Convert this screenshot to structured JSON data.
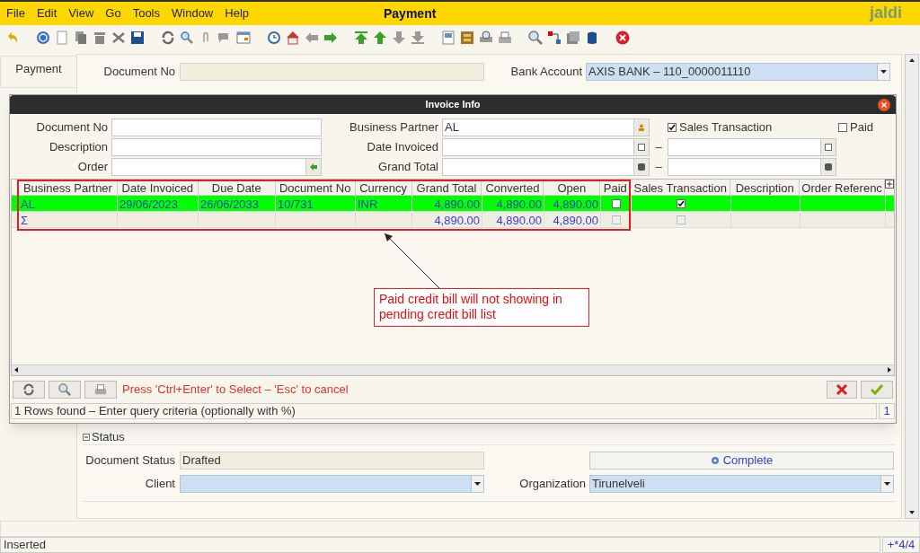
{
  "window": {
    "title": "Payment"
  },
  "menu": [
    "File",
    "Edit",
    "View",
    "Go",
    "Tools",
    "Window",
    "Help"
  ],
  "logo": "jaldi",
  "side_tabs": [
    {
      "label": "Payment",
      "selected": true
    }
  ],
  "form": {
    "document_no": {
      "label": "Document No"
    },
    "bank_account": {
      "label": "Bank Account",
      "value": "AXIS BANK – 110_0000011110"
    },
    "status_section": {
      "title": "Status",
      "expanded": true
    },
    "document_status": {
      "label": "Document Status",
      "value": "Drafted"
    },
    "complete_button": "Complete",
    "client": {
      "label": "Client"
    },
    "organization": {
      "label": "Organization",
      "value": "Tirunelveli"
    }
  },
  "dialog": {
    "title": "Invoice Info",
    "left_fields": [
      {
        "label": "Document No",
        "kind": "text"
      },
      {
        "label": "Description",
        "kind": "text"
      },
      {
        "label": "Order",
        "kind": "lookup"
      }
    ],
    "right_fields": [
      {
        "label": "Business Partner",
        "value": "AL",
        "kind": "search"
      },
      {
        "label": "Date Invoiced",
        "kind": "date_range"
      },
      {
        "label": "Grand Total",
        "kind": "number_range"
      }
    ],
    "range_separator": "–",
    "checkboxes": [
      {
        "label": "Sales Transaction",
        "checked": true
      },
      {
        "label": "Paid",
        "checked": false
      }
    ],
    "table": {
      "columns": [
        {
          "label": "Business Partner",
          "kind": "text"
        },
        {
          "label": "Date Invoiced",
          "kind": "text"
        },
        {
          "label": "Due Date",
          "kind": "text"
        },
        {
          "label": "Document No",
          "kind": "text"
        },
        {
          "label": "Currency",
          "kind": "text"
        },
        {
          "label": "Grand Total",
          "kind": "number"
        },
        {
          "label": "Converted",
          "kind": "number"
        },
        {
          "label": "Open",
          "kind": "number"
        },
        {
          "label": "Paid",
          "kind": "check"
        },
        {
          "label": "Sales Transaction",
          "kind": "check"
        },
        {
          "label": "Description",
          "kind": "text"
        },
        {
          "label": "Order Referenc",
          "kind": "text"
        }
      ],
      "rows": [
        {
          "kind": "data",
          "selected": true,
          "cells": [
            "AL",
            "29/06/2023",
            "26/06/2033",
            "10/731",
            "INR",
            "4,890.00",
            "4,890.00",
            "4,890.00",
            {
              "checked": false,
              "disabled": false
            },
            {
              "checked": true,
              "disabled": false
            },
            null,
            null
          ]
        },
        {
          "kind": "total",
          "selected": false,
          "cells": [
            "Σ",
            null,
            null,
            null,
            null,
            "4,890.00",
            "4,890.00",
            "4,890.00",
            {
              "checked": false,
              "disabled": true
            },
            {
              "checked": false,
              "disabled": true
            },
            null,
            null
          ]
        }
      ]
    },
    "hint": "Press 'Ctrl+Enter' to Select – 'Esc' to cancel",
    "status": "1 Rows found – Enter query criteria (optionally with %)",
    "count": "1",
    "annotation": "Paid credit bill will not showing in pending credit bill list"
  },
  "status_bar": {
    "message": "Inserted",
    "record": "+*4/4"
  }
}
